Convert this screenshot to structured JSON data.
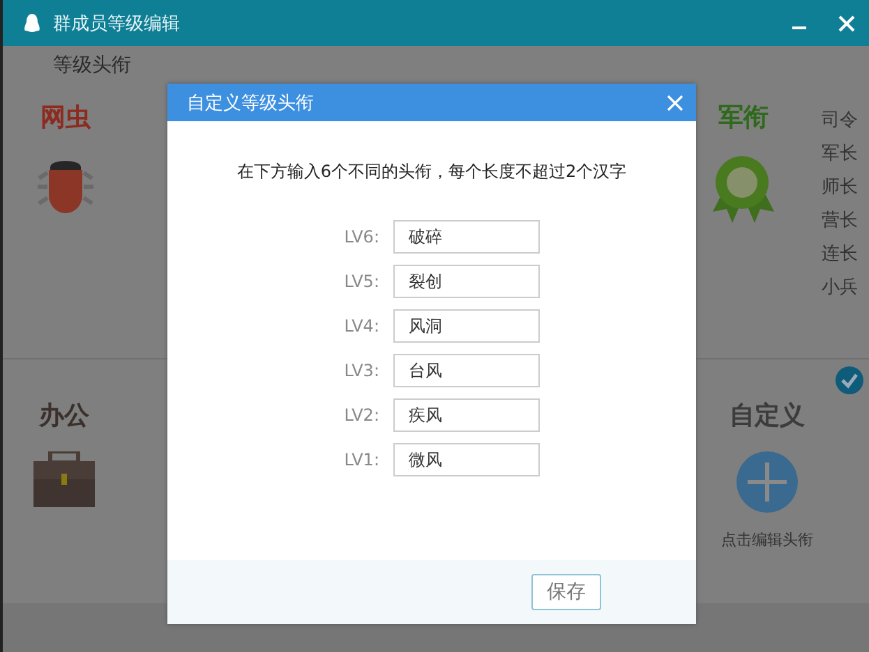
{
  "window": {
    "title": "群成员等级编辑"
  },
  "tab_title": "等级头衔",
  "sections": [
    {
      "name": "网虫",
      "kind": "bug",
      "color": "#8c2b20",
      "selected": false
    },
    {
      "name": "军衔",
      "kind": "ribbon",
      "color": "#2f6a1c",
      "selected": false,
      "items": [
        "司令",
        "军长",
        "师长",
        "营长",
        "连长",
        "小兵"
      ]
    },
    {
      "name": "办公",
      "kind": "briefcase",
      "color": "#3b302c",
      "selected": false
    },
    {
      "name": "自定义",
      "kind": "plus",
      "color": "#3c3c3c",
      "selected": true,
      "caption": "点击编辑头衔"
    }
  ],
  "dialog": {
    "title": "自定义等级头衔",
    "instruction": "在下方输入6个不同的头衔，每个长度不超过2个汉字",
    "fields": [
      {
        "label": "LV6:",
        "value": "破碎"
      },
      {
        "label": "LV5:",
        "value": "裂创"
      },
      {
        "label": "LV4:",
        "value": "风洞"
      },
      {
        "label": "LV3:",
        "value": "台风"
      },
      {
        "label": "LV2:",
        "value": "疾风"
      },
      {
        "label": "LV1:",
        "value": "微风"
      }
    ],
    "save_button": "保存"
  }
}
